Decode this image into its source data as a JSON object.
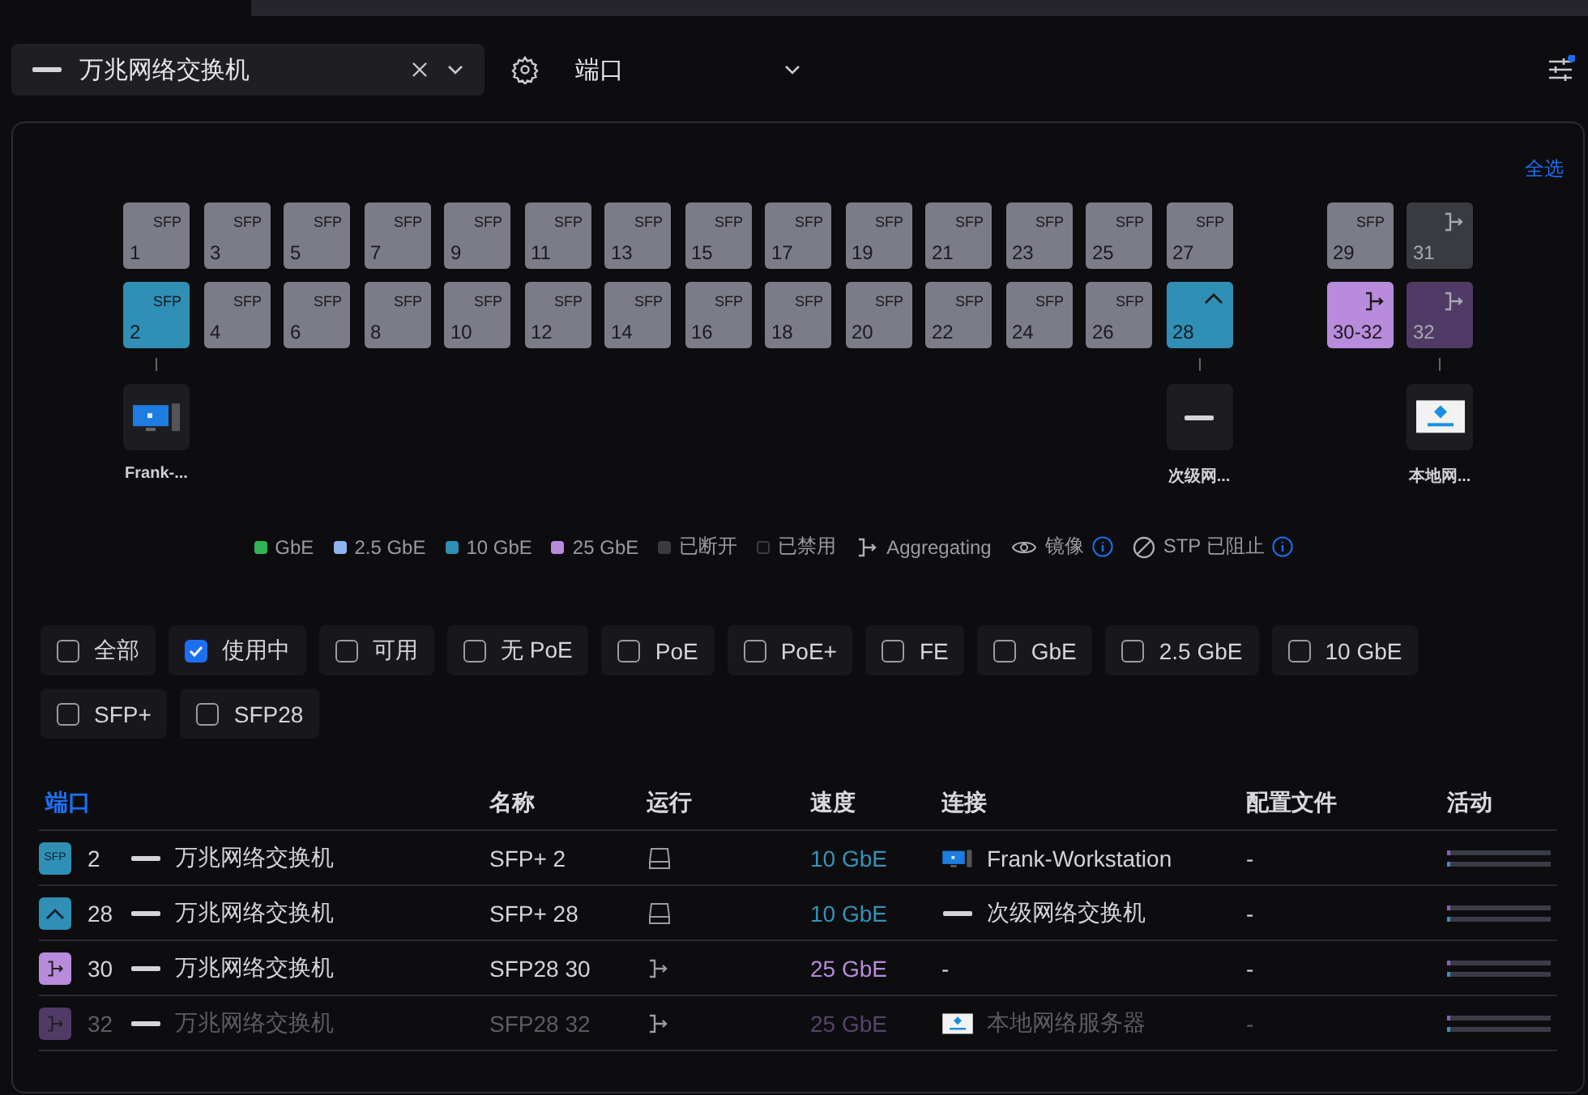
{
  "device_select": {
    "value": "万兆网络交换机"
  },
  "view_select": {
    "value": "端口"
  },
  "select_all": "全选",
  "port_columns": [
    {
      "top": {
        "label": "1",
        "kind": "module",
        "tag": "SFP",
        "color": "#7b7c87"
      },
      "bottom": {
        "label": "2",
        "kind": "module",
        "tag": "SFP",
        "color": "#2f8fb5"
      },
      "device": {
        "kind": "workstation",
        "label": "Frank-..."
      }
    },
    {
      "top": {
        "label": "3",
        "kind": "module",
        "tag": "SFP",
        "color": "#7b7c87"
      },
      "bottom": {
        "label": "4",
        "kind": "module",
        "tag": "SFP",
        "color": "#7b7c87"
      }
    },
    {
      "top": {
        "label": "5",
        "kind": "module",
        "tag": "SFP",
        "color": "#7b7c87"
      },
      "bottom": {
        "label": "6",
        "kind": "module",
        "tag": "SFP",
        "color": "#7b7c87"
      }
    },
    {
      "top": {
        "label": "7",
        "kind": "module",
        "tag": "SFP",
        "color": "#7b7c87"
      },
      "bottom": {
        "label": "8",
        "kind": "module",
        "tag": "SFP",
        "color": "#7b7c87"
      }
    },
    {
      "top": {
        "label": "9",
        "kind": "module",
        "tag": "SFP",
        "color": "#7b7c87"
      },
      "bottom": {
        "label": "10",
        "kind": "module",
        "tag": "SFP",
        "color": "#7b7c87"
      }
    },
    {
      "top": {
        "label": "11",
        "kind": "module",
        "tag": "SFP",
        "color": "#7b7c87"
      },
      "bottom": {
        "label": "12",
        "kind": "module",
        "tag": "SFP",
        "color": "#7b7c87"
      }
    },
    {
      "top": {
        "label": "13",
        "kind": "module",
        "tag": "SFP",
        "color": "#7b7c87"
      },
      "bottom": {
        "label": "14",
        "kind": "module",
        "tag": "SFP",
        "color": "#7b7c87"
      }
    },
    {
      "top": {
        "label": "15",
        "kind": "module",
        "tag": "SFP",
        "color": "#7b7c87"
      },
      "bottom": {
        "label": "16",
        "kind": "module",
        "tag": "SFP",
        "color": "#7b7c87"
      }
    },
    {
      "top": {
        "label": "17",
        "kind": "module",
        "tag": "SFP",
        "color": "#7b7c87"
      },
      "bottom": {
        "label": "18",
        "kind": "module",
        "tag": "SFP",
        "color": "#7b7c87"
      }
    },
    {
      "top": {
        "label": "19",
        "kind": "module",
        "tag": "SFP",
        "color": "#7b7c87"
      },
      "bottom": {
        "label": "20",
        "kind": "module",
        "tag": "SFP",
        "color": "#7b7c87"
      }
    },
    {
      "top": {
        "label": "21",
        "kind": "module",
        "tag": "SFP",
        "color": "#7b7c87"
      },
      "bottom": {
        "label": "22",
        "kind": "module",
        "tag": "SFP",
        "color": "#7b7c87"
      }
    },
    {
      "top": {
        "label": "23",
        "kind": "module",
        "tag": "SFP",
        "color": "#7b7c87"
      },
      "bottom": {
        "label": "24",
        "kind": "module",
        "tag": "SFP",
        "color": "#7b7c87"
      }
    },
    {
      "top": {
        "label": "25",
        "kind": "module",
        "tag": "SFP",
        "color": "#7b7c87"
      },
      "bottom": {
        "label": "26",
        "kind": "module",
        "tag": "SFP",
        "color": "#7b7c87"
      }
    },
    {
      "top": {
        "label": "27",
        "kind": "module",
        "tag": "SFP",
        "color": "#7b7c87"
      },
      "bottom": {
        "label": "28",
        "kind": "uplink",
        "color": "#2f8fb5"
      },
      "device": {
        "kind": "switch",
        "label": "次级网..."
      }
    }
  ],
  "side_columns": [
    {
      "top": {
        "label": "29",
        "kind": "module",
        "tag": "SFP",
        "color": "#7b7c87"
      },
      "bottom": {
        "label": "30-32",
        "kind": "aggregate",
        "color": "#b98bdc"
      }
    },
    {
      "top": {
        "label": "31",
        "kind": "aggregate",
        "color": "#3a3b40"
      },
      "bottom": {
        "label": "32",
        "kind": "aggregate",
        "color": "#4f3b66"
      },
      "device": {
        "kind": "server",
        "label": "本地网..."
      }
    }
  ],
  "legend": [
    {
      "kind": "swatch",
      "label": "GbE",
      "color": "#2fb457"
    },
    {
      "kind": "swatch",
      "label": "2.5 GbE",
      "color": "#8fb3ee"
    },
    {
      "kind": "swatch",
      "label": "10 GbE",
      "color": "#2f8fb5"
    },
    {
      "kind": "swatch",
      "label": "25 GbE",
      "color": "#b98bdc"
    },
    {
      "kind": "swatch",
      "label": "已断开",
      "color": "#3a3b40"
    },
    {
      "kind": "outline",
      "label": "已禁用",
      "color": "#111114"
    },
    {
      "kind": "aggregating",
      "label": "Aggregating"
    },
    {
      "kind": "mirror",
      "label": "镜像"
    },
    {
      "kind": "stp",
      "label": "STP 已阻止"
    }
  ],
  "filters": [
    {
      "label": "全部",
      "checked": false
    },
    {
      "label": "使用中",
      "checked": true
    },
    {
      "label": "可用",
      "checked": false
    },
    {
      "label": "无 PoE",
      "checked": false
    },
    {
      "label": "PoE",
      "checked": false
    },
    {
      "label": "PoE+",
      "checked": false
    },
    {
      "label": "FE",
      "checked": false
    },
    {
      "label": "GbE",
      "checked": false
    },
    {
      "label": "2.5 GbE",
      "checked": false
    },
    {
      "label": "10 GbE",
      "checked": false
    },
    {
      "label": "SFP+",
      "checked": false
    },
    {
      "label": "SFP28",
      "checked": false
    }
  ],
  "table": {
    "columns": [
      {
        "label": "端口",
        "selected": true
      },
      {
        "label": "名称",
        "selected": false
      },
      {
        "label": "运行",
        "selected": false
      },
      {
        "label": "速度",
        "selected": false
      },
      {
        "label": "连接",
        "selected": false
      },
      {
        "label": "配置文件",
        "selected": false
      },
      {
        "label": "活动",
        "selected": false
      }
    ],
    "rows": [
      {
        "badge": {
          "kind": "module",
          "tag": "SFP",
          "color": "#2f8fb5"
        },
        "port": "2",
        "device": "万兆网络交换机",
        "name": "SFP+ 2",
        "run": {
          "kind": "drive"
        },
        "speed": {
          "label": "10 GbE",
          "color": "#3592b8"
        },
        "link": {
          "kind": "workstation",
          "label": "Frank-Workstation"
        },
        "profile": "-",
        "dimmed": false
      },
      {
        "badge": {
          "kind": "uplink",
          "color": "#2f8fb5"
        },
        "port": "28",
        "device": "万兆网络交换机",
        "name": "SFP+ 28",
        "run": {
          "kind": "drive"
        },
        "speed": {
          "label": "10 GbE",
          "color": "#3592b8"
        },
        "link": {
          "kind": "switch",
          "label": "次级网络交换机"
        },
        "profile": "-",
        "dimmed": false
      },
      {
        "badge": {
          "kind": "aggregate",
          "color": "#b98bdc"
        },
        "port": "30",
        "device": "万兆网络交换机",
        "name": "SFP28 30",
        "run": {
          "kind": "aggregate"
        },
        "speed": {
          "label": "25 GbE",
          "color": "#b98bdc"
        },
        "link": {
          "label": "-"
        },
        "profile": "-",
        "dimmed": false
      },
      {
        "badge": {
          "kind": "aggregate",
          "color": "#4f3b66"
        },
        "port": "32",
        "device": "万兆网络交换机",
        "name": "SFP28 32",
        "run": {
          "kind": "aggregate"
        },
        "speed": {
          "label": "25 GbE",
          "color": "#56446e"
        },
        "link": {
          "kind": "server",
          "label": "本地网络服务器"
        },
        "profile": "-",
        "dimmed": true
      }
    ]
  }
}
